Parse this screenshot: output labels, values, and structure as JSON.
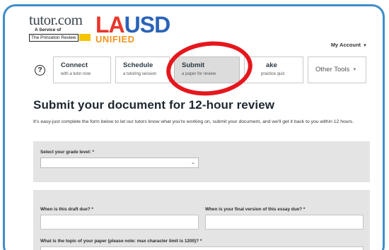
{
  "header": {
    "tutor_logo": "tutor.com",
    "tutor_service": "A Service of",
    "tutor_ptr": "The Princeton Review",
    "lausd_logo": "LAUSD",
    "lausd_unified": "UNIFIED",
    "my_account": "My Account",
    "my_account_caret": "▼"
  },
  "nav": {
    "help_icon": "?",
    "tabs": [
      {
        "title": "Connect",
        "subtitle": "with a tutor now"
      },
      {
        "title": "Schedule",
        "subtitle": "a tutoring session"
      },
      {
        "title": "Submit",
        "subtitle": "a paper for review"
      },
      {
        "title": "ake",
        "subtitle": "practice quiz"
      }
    ],
    "other_tools": "Other Tools",
    "other_tools_caret": "▼"
  },
  "main": {
    "title": "Submit your document for 12-hour review",
    "intro": "It's easy-just complete the form below to let our tutors know what you're working on, submit your document, and we'll get it back to you within 12 hours."
  },
  "form": {
    "grade_label": "Select your grade level: *",
    "grade_value": "",
    "draft_due_label": "When is this draft due? *",
    "final_due_label": "When is your final version of this essay due? *",
    "topic_label": "What is the topic of your paper (please note: max character limit is 1200)? *"
  },
  "colors": {
    "frame_border": "#3d8ec9",
    "highlight_circle": "#e5171d",
    "lausd_red": "#e8362b",
    "lausd_blue": "#2a63b8",
    "lausd_orange": "#f19420",
    "panel_bg": "#e4e4e4"
  }
}
